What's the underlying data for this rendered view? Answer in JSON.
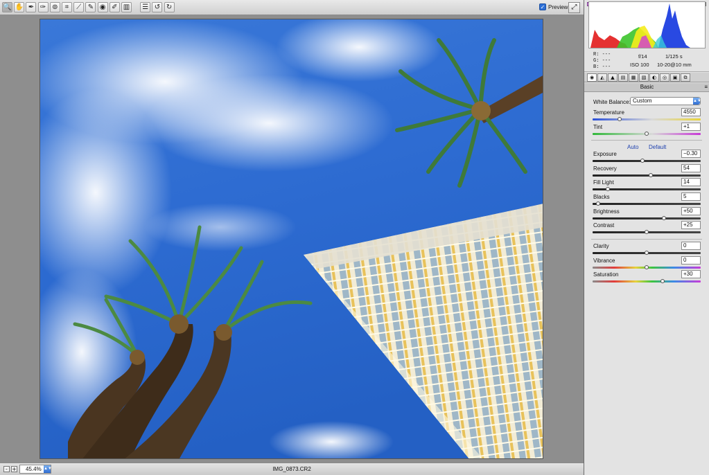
{
  "toolbar": {
    "tools": [
      {
        "name": "zoom-tool",
        "icon": "🔍"
      },
      {
        "name": "hand-tool",
        "icon": "✋"
      },
      {
        "name": "white-balance-tool",
        "icon": "✒"
      },
      {
        "name": "color-sampler-tool",
        "icon": "✑"
      },
      {
        "name": "targeted-adjustment-tool",
        "icon": "⊚"
      },
      {
        "name": "crop-tool",
        "icon": "⌗"
      },
      {
        "name": "straighten-tool",
        "icon": "⟋"
      },
      {
        "name": "spot-removal-tool",
        "icon": "✎"
      },
      {
        "name": "red-eye-tool",
        "icon": "◉"
      },
      {
        "name": "adjustment-brush-tool",
        "icon": "✐"
      },
      {
        "name": "graduated-filter-tool",
        "icon": "▥"
      },
      {
        "name": "preferences-tool",
        "icon": "☰"
      },
      {
        "name": "rotate-left-tool",
        "icon": "↺"
      },
      {
        "name": "rotate-right-tool",
        "icon": "↻"
      }
    ],
    "preview_label": "Preview",
    "preview_checked": "✓",
    "fullscreen_icon": "⤢"
  },
  "status": {
    "zoom_minus": "-",
    "zoom_plus": "+",
    "zoom_value": "45.4%",
    "filename": "IMG_0873.CR2"
  },
  "readout": {
    "r": "R:  ---",
    "g": "G:  ---",
    "b": "B:  ---",
    "aperture": "f/14",
    "shutter": "1/125 s",
    "iso": "ISO 100",
    "lens": "10-20@10 mm"
  },
  "panel": {
    "tab_icons": [
      "◉",
      "◭",
      "▲",
      "▤",
      "▦",
      "▧",
      "◐",
      "◎",
      "▣",
      "⧉"
    ],
    "section_title": "Basic",
    "section_menu_icon": "≡",
    "white_balance_label": "White Balance:",
    "white_balance_value": "Custom",
    "auto_link": "Auto",
    "default_link": "Default",
    "controls": [
      {
        "label": "Temperature",
        "value": "4550",
        "level": 0.25,
        "track": "temp"
      },
      {
        "label": "Tint",
        "value": "+1",
        "level": 0.5,
        "track": "tint"
      },
      {
        "label": "Exposure",
        "value": "−0.30",
        "level": 0.46,
        "track": "gray"
      },
      {
        "label": "Recovery",
        "value": "54",
        "level": 0.54,
        "track": "gray"
      },
      {
        "label": "Fill Light",
        "value": "14",
        "level": 0.14,
        "track": "gray"
      },
      {
        "label": "Blacks",
        "value": "5",
        "level": 0.05,
        "track": "gray"
      },
      {
        "label": "Brightness",
        "value": "+50",
        "level": 0.66,
        "track": "gray"
      },
      {
        "label": "Contrast",
        "value": "+25",
        "level": 0.5,
        "track": "gray"
      },
      {
        "label": "Clarity",
        "value": "0",
        "level": 0.5,
        "track": "gray"
      },
      {
        "label": "Vibrance",
        "value": "0",
        "level": 0.5,
        "track": "sat"
      },
      {
        "label": "Saturation",
        "value": "+30",
        "level": 0.65,
        "track": "sat"
      }
    ]
  }
}
